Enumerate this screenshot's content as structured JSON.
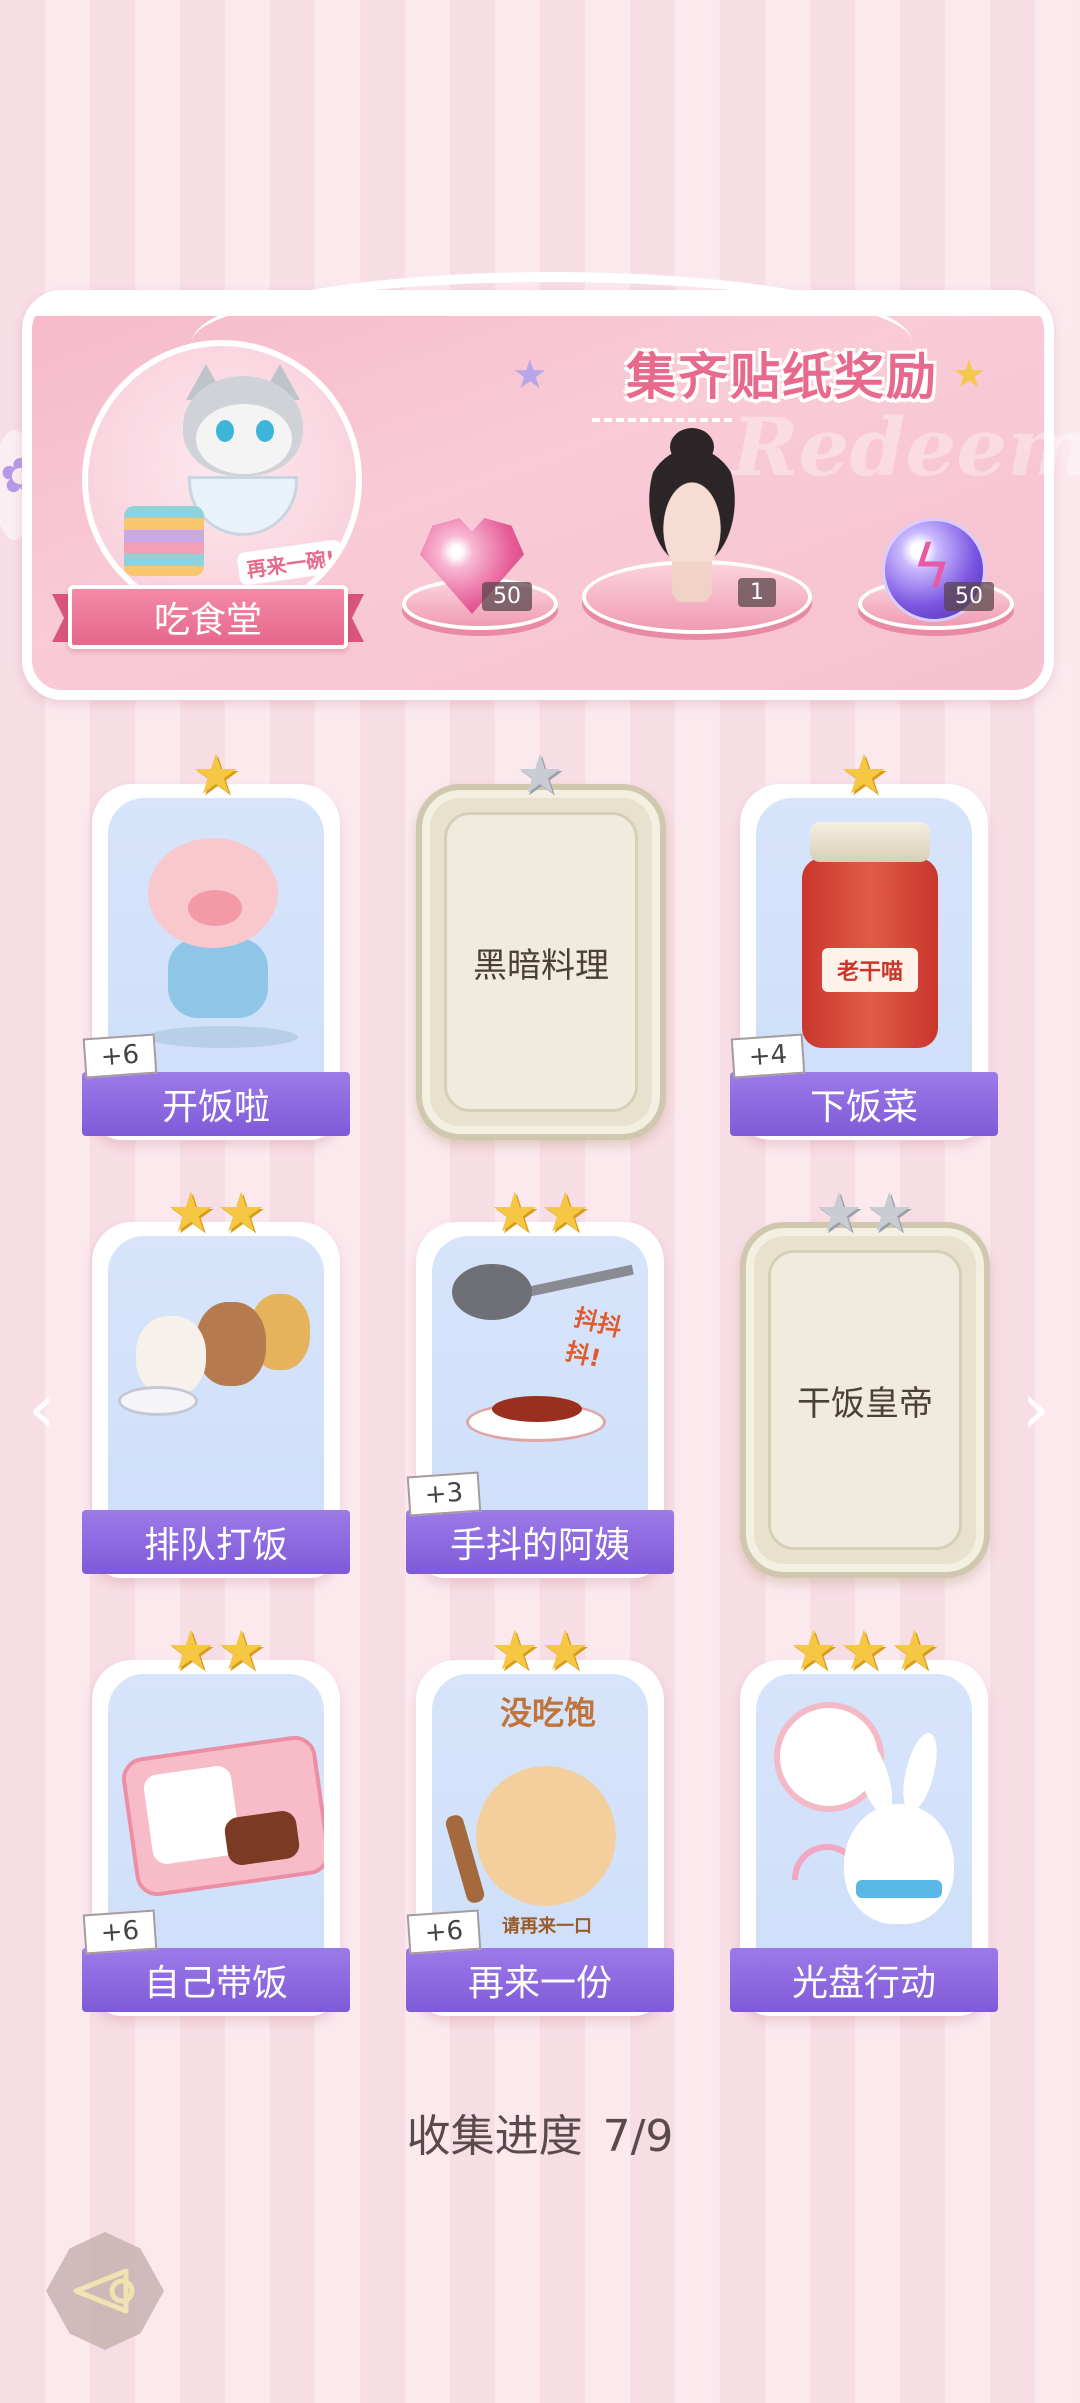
{
  "banner": {
    "title": "集齐贴纸奖励",
    "watermark": "Redeem",
    "collection_name": "吃食堂",
    "avatar_tag": "再来一碗!",
    "rewards": [
      {
        "icon": "pink-heart-gem-icon",
        "count": "50"
      },
      {
        "icon": "woman-portrait-avatar",
        "count": "1"
      },
      {
        "icon": "purple-lightning-orb-icon",
        "count": "50"
      }
    ]
  },
  "stickers": [
    {
      "label": "开饭啦",
      "stars": 1,
      "unlocked": true,
      "bonus": "+6"
    },
    {
      "label": "黑暗料理",
      "stars": 1,
      "unlocked": false,
      "bonus": ""
    },
    {
      "label": "下饭菜",
      "stars": 1,
      "unlocked": true,
      "bonus": "+4",
      "jar_text": "老干喵"
    },
    {
      "label": "排队打饭",
      "stars": 2,
      "unlocked": true,
      "bonus": ""
    },
    {
      "label": "手抖的阿姨",
      "stars": 2,
      "unlocked": true,
      "bonus": "+3",
      "art_text": "抖抖抖!"
    },
    {
      "label": "干饭皇帝",
      "stars": 2,
      "unlocked": false,
      "bonus": ""
    },
    {
      "label": "自己带饭",
      "stars": 2,
      "unlocked": true,
      "bonus": "+6"
    },
    {
      "label": "再来一份",
      "stars": 2,
      "unlocked": true,
      "bonus": "+6",
      "art_top": "没吃饱",
      "art_bottom": "请再来一口"
    },
    {
      "label": "光盘行动",
      "stars": 3,
      "unlocked": true,
      "bonus": ""
    }
  ],
  "progress": {
    "label": "收集进度",
    "value": "7/9"
  },
  "colors": {
    "accent_pink": "#e76a8c",
    "label_purple": "#8a66e0",
    "star_gold": "#f6c743",
    "star_gray": "#c9ccd2"
  }
}
